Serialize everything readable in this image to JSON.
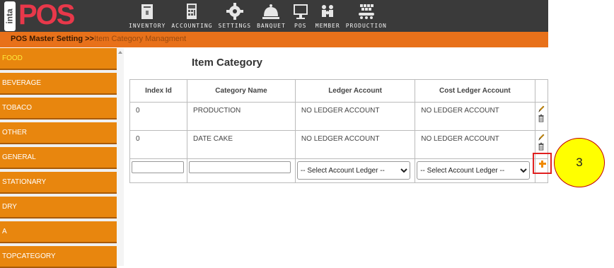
{
  "logo": {
    "vertical_text": "inta",
    "main_text": "POS"
  },
  "nav": [
    {
      "label": "INVENTORY",
      "icon": "inventory-icon"
    },
    {
      "label": "ACCOUNTING",
      "icon": "calculator-icon"
    },
    {
      "label": "SETTINGS",
      "icon": "gear-icon"
    },
    {
      "label": "BANQUET",
      "icon": "cloche-icon"
    },
    {
      "label": "POS",
      "icon": "monitor-icon"
    },
    {
      "label": "MEMBER",
      "icon": "members-icon"
    },
    {
      "label": "PRODUCTION",
      "icon": "production-icon"
    }
  ],
  "breadcrumb": {
    "main": "POS Master Setting >>",
    "current": "Item Category Managment"
  },
  "sidebar": {
    "active": "FOOD",
    "items": [
      "FOOD",
      "BEVERAGE",
      "TOBACO",
      "OTHER",
      "GENERAL",
      "STATIONARY",
      "DRY",
      "A",
      "TOPCATEGORY"
    ]
  },
  "page": {
    "title": "Item Category"
  },
  "table": {
    "headers": [
      "Index Id",
      "Category Name",
      "Ledger Account",
      "Cost Ledger Account"
    ],
    "rows": [
      {
        "index_id": "0",
        "category_name": "PRODUCTION",
        "ledger_account": "NO LEDGER ACCOUNT",
        "cost_ledger_account": "NO LEDGER ACCOUNT"
      },
      {
        "index_id": "0",
        "category_name": "DATE CAKE",
        "ledger_account": "NO LEDGER ACCOUNT",
        "cost_ledger_account": "NO LEDGER ACCOUNT"
      }
    ],
    "new_row": {
      "index_id": "",
      "category_name": "",
      "ledger_select": "-- Select Account Ledger --",
      "cost_ledger_select": "-- Select Account Ledger --"
    }
  },
  "callout": {
    "label": "3"
  },
  "colors": {
    "topbar": "#3a3a3a",
    "accent": "#e8711a",
    "sidebar_item": "#e8860e",
    "active_text": "#ffeb3b",
    "callout_fill": "#ffff00",
    "highlight_border": "#e02020"
  }
}
